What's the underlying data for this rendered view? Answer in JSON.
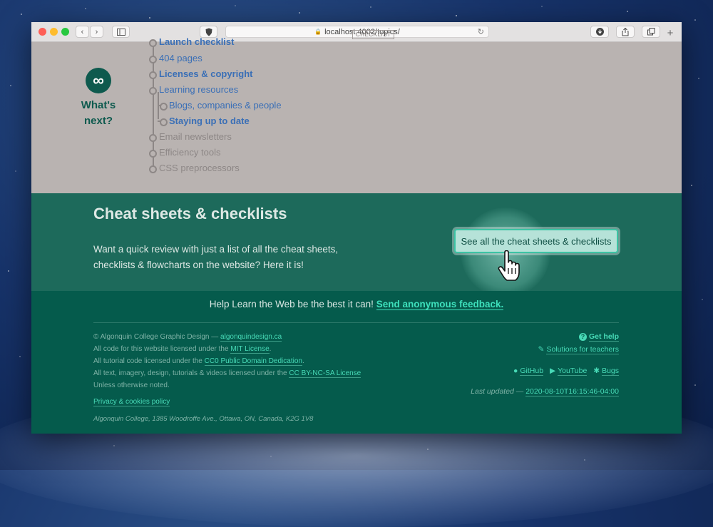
{
  "browser": {
    "url": "localhost:4002/topics/",
    "lock_glyph": "🔒"
  },
  "topics": {
    "badge_symbol": "∞",
    "heading": "What's next?",
    "items": [
      {
        "label": "Launch checklist",
        "tag": "CHECKLIST"
      },
      {
        "label": "404 pages"
      },
      {
        "label": "Licenses & copyright"
      },
      {
        "label": "Learning resources"
      },
      {
        "label": "Blogs, companies & people"
      },
      {
        "label": "Staying up to date"
      },
      {
        "label": "Email newsletters"
      },
      {
        "label": "Efficiency tools"
      },
      {
        "label": "CSS preprocessors"
      }
    ]
  },
  "cheat": {
    "title": "Cheat sheets & checklists",
    "description": "Want a quick review with just a list of all the cheat sheets, checklists & flowcharts on the website? Here it is!",
    "button": "See all the cheat sheets & checklists"
  },
  "footer": {
    "feedback_text": "Help Learn the Web be the best it can!",
    "feedback_link": "Send anonymous feedback.",
    "copyright_prefix": "© Algonquin College Graphic Design — ",
    "copyright_link": "algonquindesign.ca",
    "code_prefix": "All code for this website licensed under the ",
    "code_link": "MIT License",
    "tutorial_prefix": "All tutorial code licensed under the ",
    "tutorial_link": "CC0 Public Domain Dedication",
    "text_prefix": "All text, imagery, design, tutorials & videos licensed under the ",
    "text_link": "CC BY-NC-SA License",
    "unless": "Unless otherwise noted.",
    "privacy": "Privacy & cookies policy",
    "address": "Algonquin College, 1385 Woodroffe Ave., Ottawa, ON, Canada, K2G 1V8",
    "get_help": "Get help",
    "solutions": "Solutions for teachers",
    "github": "GitHub",
    "youtube": "YouTube",
    "bugs": "Bugs",
    "updated_prefix": "Last updated — ",
    "updated": "2020-08-10T16:15:46-04:00",
    "period": "."
  }
}
